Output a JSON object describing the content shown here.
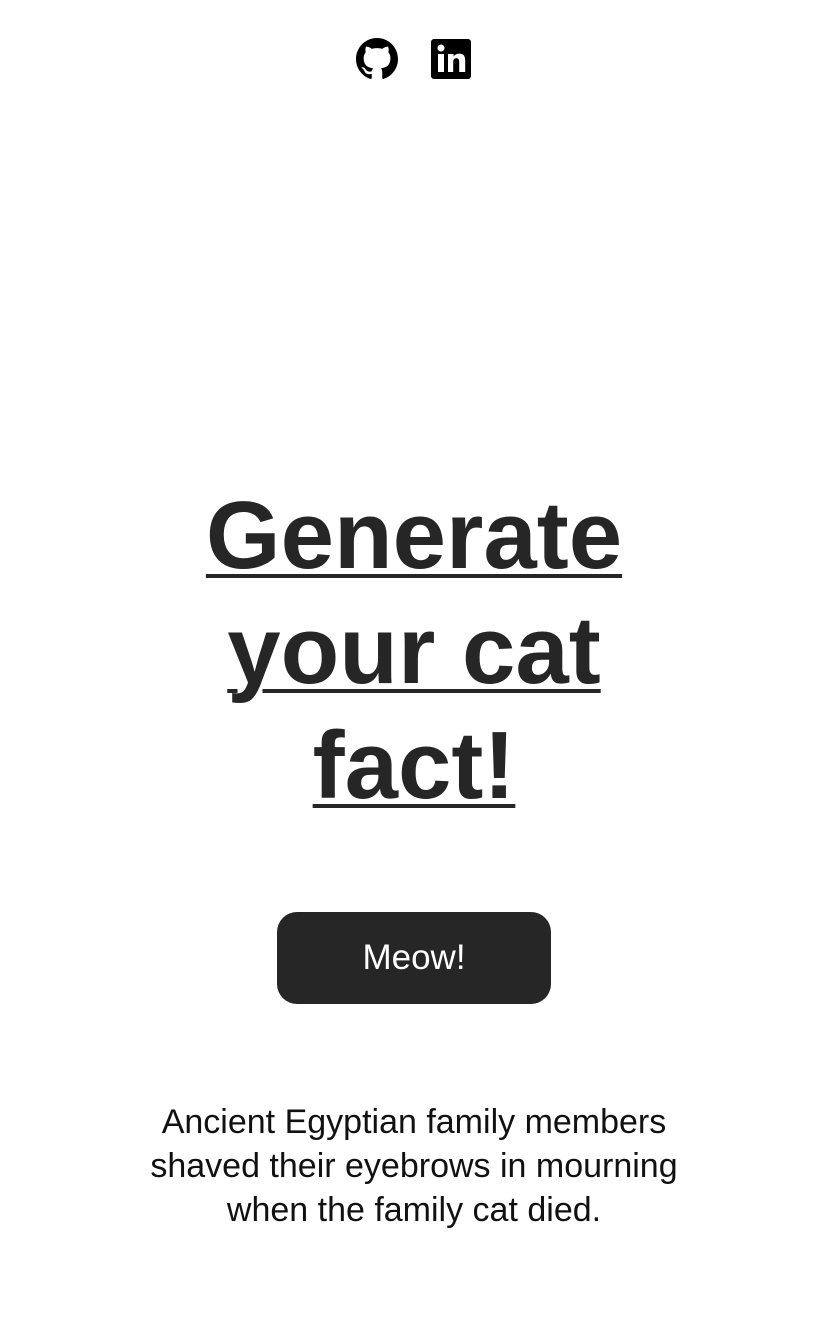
{
  "social": {
    "links": [
      {
        "name": "github",
        "icon": "github-icon"
      },
      {
        "name": "linkedin",
        "icon": "linkedin-icon"
      }
    ]
  },
  "hero": {
    "title": "Generate your cat fact!"
  },
  "action": {
    "button_label": "Meow!"
  },
  "fact": {
    "text": "Ancient Egyptian family members shaved their eyebrows in mourning when the family cat died."
  },
  "colors": {
    "primary": "#262626",
    "background": "#ffffff"
  }
}
